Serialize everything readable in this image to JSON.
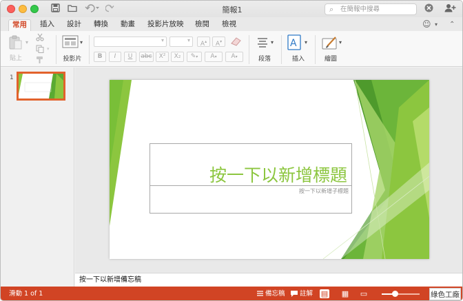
{
  "app": {
    "window_title": "簡報1",
    "search_placeholder": "在簡報中搜尋"
  },
  "titlebar_icons": [
    "save-icon",
    "open-folder-icon",
    "undo-icon",
    "redo-icon",
    "clear-icon",
    "add-user-icon"
  ],
  "tabs": [
    "常用",
    "插入",
    "設計",
    "轉換",
    "動畫",
    "投影片放映",
    "檢閱",
    "檢視"
  ],
  "active_tab": "常用",
  "ribbon": {
    "paste_label": "貼上",
    "layout_label": "投影片",
    "paragraph_label": "段落",
    "insert_label": "插入",
    "draw_label": "繪圖",
    "format_buttons": [
      "B",
      "I",
      "U",
      "abc",
      "X²",
      "X₂"
    ]
  },
  "slide_pane": {
    "slide_number": "1"
  },
  "slide": {
    "title_placeholder": "按一下以新增標題",
    "subtitle_placeholder": "按一下以新增子標題",
    "accent_colors": [
      "#8cc63f",
      "#5aaa32",
      "#b8dd6e"
    ]
  },
  "notes": {
    "placeholder": "按一下以新增備忘稿"
  },
  "status": {
    "slide_position": "滑動 1 of 1",
    "notes_label": "備忘稿",
    "comments_label": "註解",
    "zoom_level": 0.35,
    "watermark": "綠色工廠"
  },
  "colors": {
    "accent": "#d24726",
    "status_bar": "#d14424"
  }
}
